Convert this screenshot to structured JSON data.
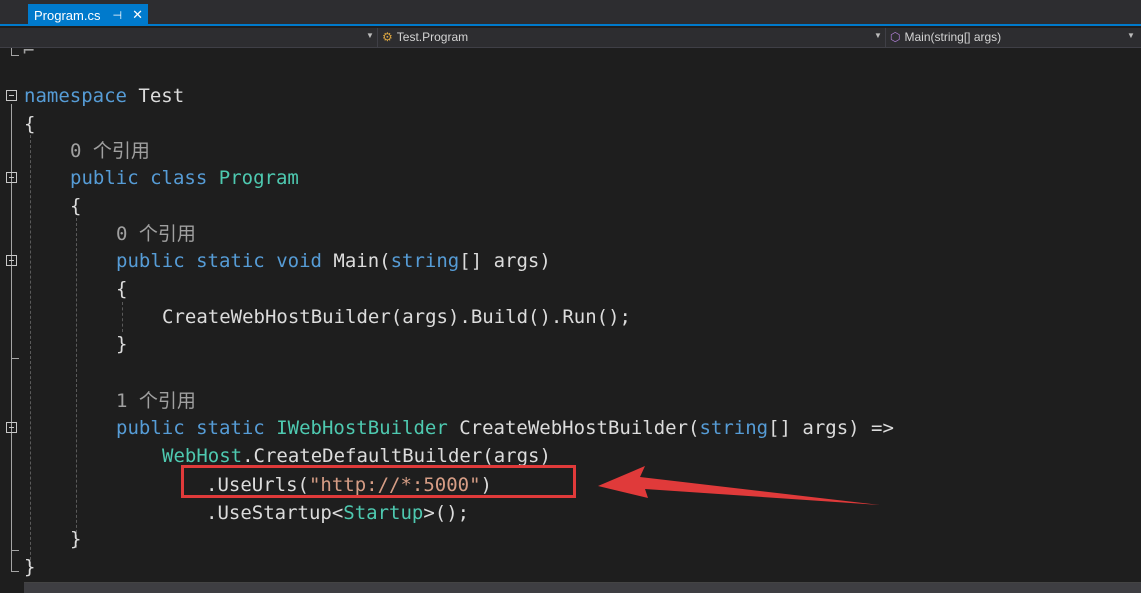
{
  "tab": {
    "label": "Program.cs",
    "pin": "⊣",
    "close": "✕"
  },
  "navbar": {
    "class_selector": "Test.Program",
    "member_selector": "Main(string[] args)",
    "class_icon": "class-icon",
    "method_icon": "method-icon"
  },
  "code": {
    "namespace_kw": "namespace",
    "namespace_name": "Test",
    "open_brace": "{",
    "close_brace": "}",
    "ref0": "0 个引用",
    "ref1": "1 个引用",
    "public": "public",
    "class": "class",
    "class_name": "Program",
    "static": "static",
    "void": "void",
    "main": "Main(",
    "string": "string",
    "args_close": "[] args)",
    "main_body": "CreateWebHostBuilder(args).Build().Run();",
    "iwebhostbuilder": "IWebHostBuilder",
    "cwhb": "CreateWebHostBuilder(",
    "args_arrow": "[] args) =>",
    "webhost": "WebHost",
    "create_default": ".CreateDefaultBuilder(args)",
    "useurls_pre": ".UseUrls(",
    "url_string": "\"http://*:5000\"",
    "useurls_post": ")",
    "usestartup_pre": ".UseStartup<",
    "startup": "Startup",
    "usestartup_post": ">();"
  },
  "annotation": {
    "highlight_color": "#e03a3a",
    "arrow_color": "#e03a3a"
  }
}
